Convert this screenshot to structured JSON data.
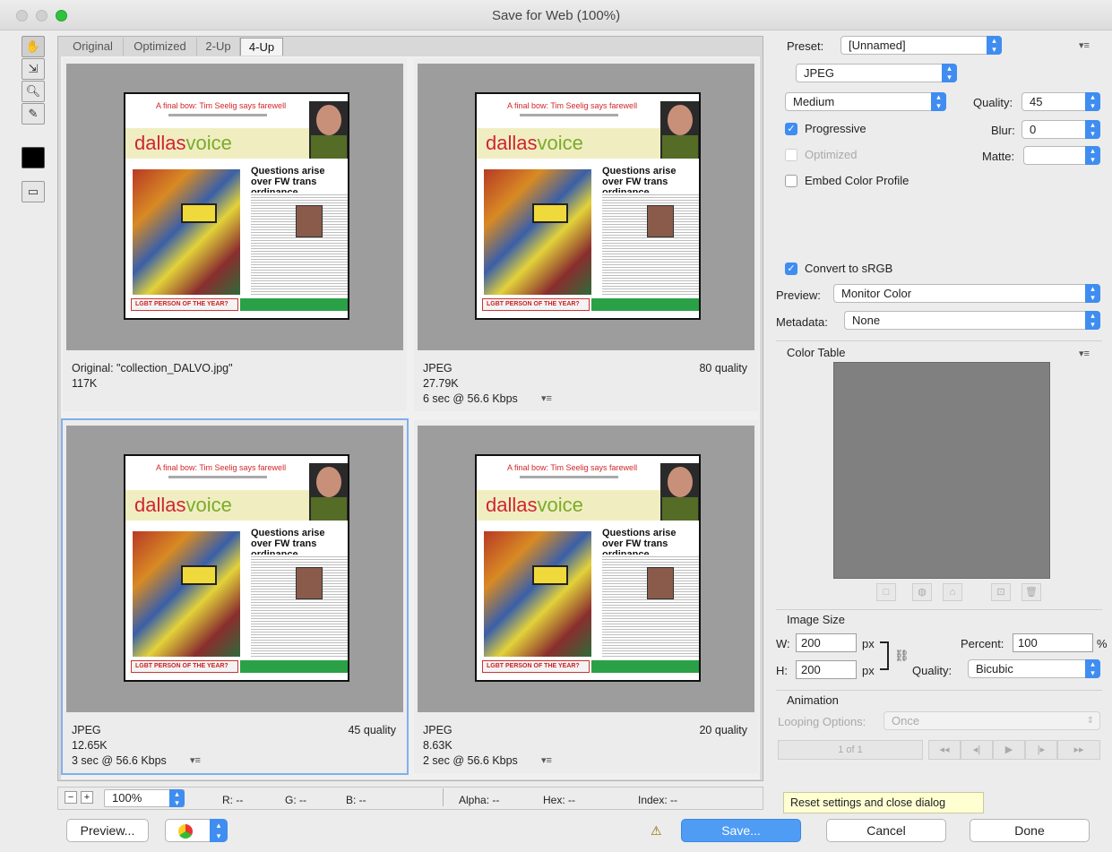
{
  "window": {
    "title": "Save for Web (100%)"
  },
  "colors": {
    "accent": "#3f8df0",
    "primary_button": "#4f9cf5",
    "selected_outline": "#7fb0ea",
    "color_table": "#808080"
  },
  "tools": [
    "hand-icon",
    "slice-select-icon",
    "zoom-icon",
    "eyedropper-icon",
    "eyedropper-color-swatch",
    "toggle-slices-icon"
  ],
  "tabs": [
    "Original",
    "Optimized",
    "2-Up",
    "4-Up"
  ],
  "thumbnail": {
    "headline": "A final bow: Tim Seelig says farewell",
    "logo_dallas": "dallas",
    "logo_voice": "voice",
    "story": "Questions arise over FW trans ordinance",
    "footer": "LGBT PERSON OF THE YEAR?"
  },
  "panes": [
    {
      "line1": "Original: \"collection_DALVO.jpg\"",
      "line2": "117K",
      "line3": "",
      "quality": "",
      "menu": ""
    },
    {
      "line1": "JPEG",
      "line2": "27.79K",
      "line3": "6 sec @ 56.6 Kbps",
      "quality": "80 quality",
      "menu": "▾≡"
    },
    {
      "line1": "JPEG",
      "line2": "12.65K",
      "line3": "3 sec @ 56.6 Kbps",
      "quality": "45 quality",
      "menu": "▾≡"
    },
    {
      "line1": "JPEG",
      "line2": "8.63K",
      "line3": "2 sec @ 56.6 Kbps",
      "quality": "20 quality",
      "menu": "▾≡"
    }
  ],
  "settings": {
    "preset_label": "Preset:",
    "preset_value": "[Unnamed]",
    "format": "JPEG",
    "compression": "Medium",
    "quality_label": "Quality:",
    "quality_value": "45",
    "progressive_label": "Progressive",
    "progressive": true,
    "blur_label": "Blur:",
    "blur_value": "0",
    "optimized_label": "Optimized",
    "matte_label": "Matte:",
    "embed_label": "Embed Color Profile",
    "convert_label": "Convert to sRGB",
    "convert": true,
    "preview_label": "Preview:",
    "preview_value": "Monitor Color",
    "metadata_label": "Metadata:",
    "metadata_value": "None"
  },
  "color_table": {
    "title": "Color Table"
  },
  "image_size": {
    "title": "Image Size",
    "w_label": "W:",
    "w_value": "200",
    "h_label": "H:",
    "h_value": "200",
    "unit": "px",
    "percent_label": "Percent:",
    "percent_value": "100",
    "percent_unit": "%",
    "quality_label": "Quality:",
    "quality_value": "Bicubic"
  },
  "animation": {
    "title": "Animation",
    "looping_label": "Looping Options:",
    "looping_value": "Once",
    "frame": "1 of 1"
  },
  "status": {
    "zoom": "100%",
    "r": "R: --",
    "g": "G: --",
    "b": "B: --",
    "alpha": "Alpha: --",
    "hex": "Hex: --",
    "index": "Index: --"
  },
  "buttons": {
    "preview": "Preview...",
    "save": "Save...",
    "cancel": "Cancel",
    "done": "Done"
  },
  "tooltip": "Reset settings and close dialog"
}
